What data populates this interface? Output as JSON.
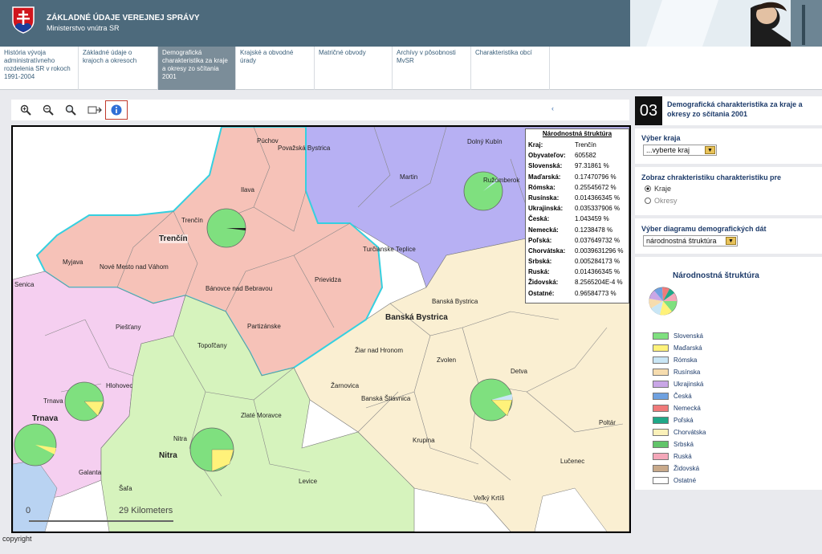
{
  "header": {
    "title": "ZÁKLADNÉ ÚDAJE VEREJNEJ SPRÁVY",
    "subtitle": "Ministerstvo vnútra SR"
  },
  "nav": {
    "tabs": [
      {
        "label": "História vývoja administratívneho rozdelenia SR v rokoch 1991-2004"
      },
      {
        "label": "Základné údaje o krajoch a okresoch"
      },
      {
        "label": "Demografická charakteristika za kraje a okresy zo sčítania 2001"
      },
      {
        "label": "Krajské a obvodné úrady"
      },
      {
        "label": "Matričné obvody"
      },
      {
        "label": "Archívy v pôsobnosti MvSR"
      },
      {
        "label": "Charakteristika obcí"
      }
    ]
  },
  "toolbar": {
    "collapse": "‹"
  },
  "map": {
    "scale_zero": "0",
    "scale_label": "29 Kilometers",
    "copyright": "copyright",
    "regions": [
      "Trenčín",
      "Banská Bystrica",
      "Trnava",
      "Nitra"
    ],
    "towns": [
      "Púchov",
      "Považská Bystrica",
      "Dolný Kubín",
      "Martin",
      "Ružomberok",
      "Ilava",
      "Trenčín",
      "Myjava",
      "Nové Mesto nad Váhom",
      "Turčianske Teplice",
      "Bánovce nad Bebravou",
      "Prievidza",
      "Senica",
      "Partizánske",
      "Banská Bystrica",
      "Piešťany",
      "Topoľčany",
      "Žiar nad Hronom",
      "Zvolen",
      "Hlohovec",
      "Žarnovica",
      "Banská Štiavnica",
      "Detva",
      "Trnava",
      "Zlaté Moravce",
      "Poltár",
      "Nitra",
      "Krupina",
      "Lučenec",
      "Galanta",
      "Levice",
      "Šaľa",
      "Veľký Krtíš"
    ]
  },
  "statbox": {
    "title": "Národnostná štruktúra",
    "rows": [
      {
        "k": "Kraj:",
        "v": "Trenčín"
      },
      {
        "k": "Obyvateľov:",
        "v": "605582"
      },
      {
        "k": "Slovenská:",
        "v": "97.31861 %"
      },
      {
        "k": "Maďarská:",
        "v": "0.17470796 %"
      },
      {
        "k": "Rómska:",
        "v": "0.25545672 %"
      },
      {
        "k": "Rusínska:",
        "v": "0.014366345 %"
      },
      {
        "k": "Ukrajinská:",
        "v": "0.035337906 %"
      },
      {
        "k": "Česká:",
        "v": "1.043459 %"
      },
      {
        "k": "Nemecká:",
        "v": "0.1238478 %"
      },
      {
        "k": "Poľská:",
        "v": "0.037649732 %"
      },
      {
        "k": "Chorvátska:",
        "v": "0.0039631296 %"
      },
      {
        "k": "Srbská:",
        "v": "0.005284173 %"
      },
      {
        "k": "Ruská:",
        "v": "0.014366345 %"
      },
      {
        "k": "Židovská:",
        "v": "8.2565204E-4 %"
      },
      {
        "k": "Ostatné:",
        "v": "0.96584773 %"
      }
    ]
  },
  "right": {
    "number": "03",
    "title": "Demografická charakteristika za kraje a okresy zo sčítania 2001",
    "kraj_label": "Výber kraja",
    "kraj_value": "...vyberte kraj",
    "zobraz_label": "Zobraz chrakteristiku charakteristiku pre",
    "radio_kraje": "Kraje",
    "radio_okresy": "Okresy",
    "diagram_label": "Výber diagramu demografických dát",
    "diagram_value": "národnostná štruktúra",
    "legend_title": "Národnostná štruktúra",
    "legend": [
      {
        "label": "Slovenská",
        "color": "#7fe07f"
      },
      {
        "label": "Maďarská",
        "color": "#fff27a"
      },
      {
        "label": "Rómska",
        "color": "#c9e6f5"
      },
      {
        "label": "Rusínska",
        "color": "#f6dcae"
      },
      {
        "label": "Ukrajinská",
        "color": "#c9a6e6"
      },
      {
        "label": "Česká",
        "color": "#6fa1e0"
      },
      {
        "label": "Nemecká",
        "color": "#f07a7a"
      },
      {
        "label": "Poľská",
        "color": "#1fa888"
      },
      {
        "label": "Chorvátska",
        "color": "#fbf1b9"
      },
      {
        "label": "Srbská",
        "color": "#62c46a"
      },
      {
        "label": "Ruská",
        "color": "#f4a7b9"
      },
      {
        "label": "Židovská",
        "color": "#c8a98a"
      },
      {
        "label": "Ostatné",
        "color": "#ffffff"
      }
    ]
  },
  "colors": {
    "header": "#4d6a7c",
    "trencin_region": "#f6c2b8",
    "zilina_region": "#b7b0f3",
    "bb_region": "#faefd2",
    "trnava_region": "#f5cff0",
    "nitra_region": "#d6f3bd",
    "highlight_border": "#35d0e0"
  }
}
